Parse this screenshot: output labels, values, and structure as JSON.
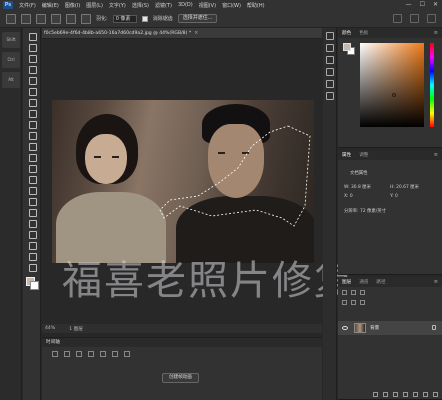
{
  "app": {
    "logo": "Ps"
  },
  "menu": [
    "文件(F)",
    "编辑(E)",
    "图像(I)",
    "图层(L)",
    "文字(Y)",
    "选择(S)",
    "滤镜(T)",
    "3D(D)",
    "视图(V)",
    "窗口(W)",
    "帮助(H)"
  ],
  "window_controls": [
    "—",
    "☐",
    "✕"
  ],
  "options_bar": {
    "feather_label": "羽化:",
    "feather_value": "0 像素",
    "antialias_label": "消除锯齿",
    "select_mask_button": "选择并遮住..."
  },
  "left_tabs": [
    "Shift",
    "Ctrl",
    "Alt"
  ],
  "document": {
    "tab_title": "f0c5eb69e-4f6d-4b8b-a650-16a7d60cd9a2.jpg @ 44%(RGB/8) *",
    "zoom": "44%",
    "doc_info": "1 图层"
  },
  "watermark": "福喜老照片修复",
  "timeline": {
    "title": "时间轴",
    "create_button": "创建帧动画"
  },
  "color_panel": {
    "tabs": [
      "颜色",
      "色板"
    ],
    "fg_color": "#c7b8ac",
    "bg_color": "#ffffff",
    "accent": "#ee7a17"
  },
  "properties_panel": {
    "tabs": [
      "属性",
      "调整"
    ],
    "section": "文档属性",
    "w_label": "W: 30.8 厘米",
    "h_label": "H: 20.67 厘米",
    "x_label": "X: 0",
    "y_label": "Y: 0",
    "resolution_label": "分辨率: 72 像素/英寸"
  },
  "layers_panel": {
    "tabs": [
      "图层",
      "通道",
      "路径"
    ],
    "layer_name": "背景"
  }
}
